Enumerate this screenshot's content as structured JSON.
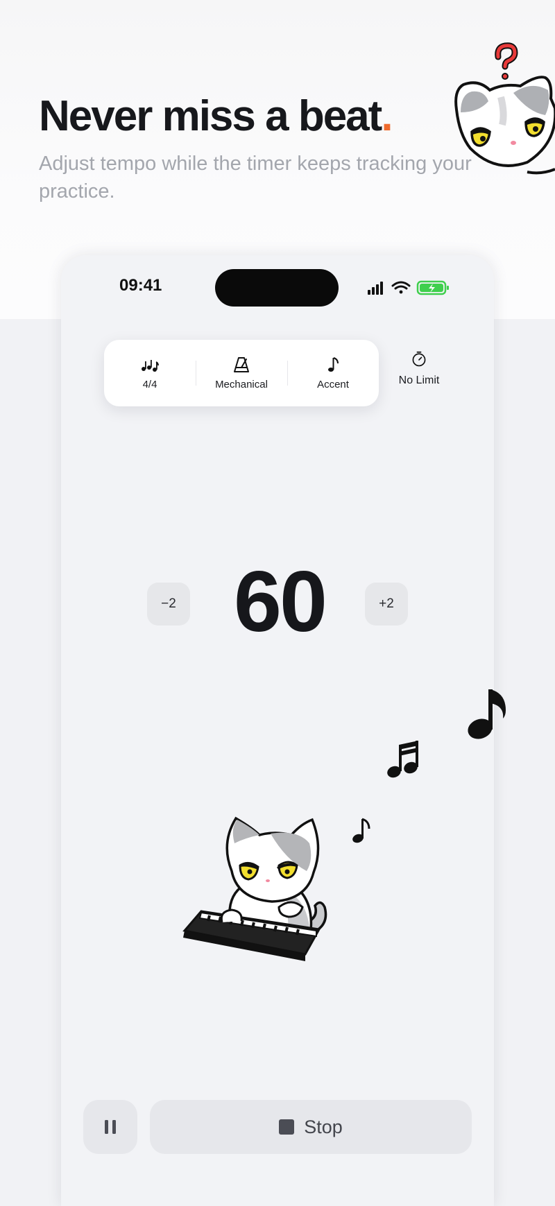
{
  "hero": {
    "headline": "Never miss a beat",
    "headline_dot": ".",
    "subheadline": "Adjust tempo while the timer keeps tracking your practice."
  },
  "status_bar": {
    "time": "09:41",
    "icons": [
      "signal-icon",
      "wifi-icon",
      "battery-charging-icon"
    ]
  },
  "toolbar": {
    "items": [
      {
        "icon": "time-signature-notes-icon",
        "label": "4/4"
      },
      {
        "icon": "metronome-icon",
        "label": "Mechanical"
      },
      {
        "icon": "eighth-note-icon",
        "label": "Accent"
      }
    ],
    "timer": {
      "icon": "timer-icon",
      "label": "No Limit"
    }
  },
  "tempo": {
    "bpm": "60",
    "decrement_label": "−2",
    "increment_label": "+2"
  },
  "controls": {
    "pause_icon": "pause-icon",
    "stop_label": "Stop",
    "stop_icon": "stop-icon"
  },
  "colors": {
    "accent": "#ee6a2d",
    "text_primary": "#17181c",
    "text_secondary": "#a3a6ad",
    "button_bg": "#e6e7eb",
    "battery_green": "#3fcf4d"
  }
}
